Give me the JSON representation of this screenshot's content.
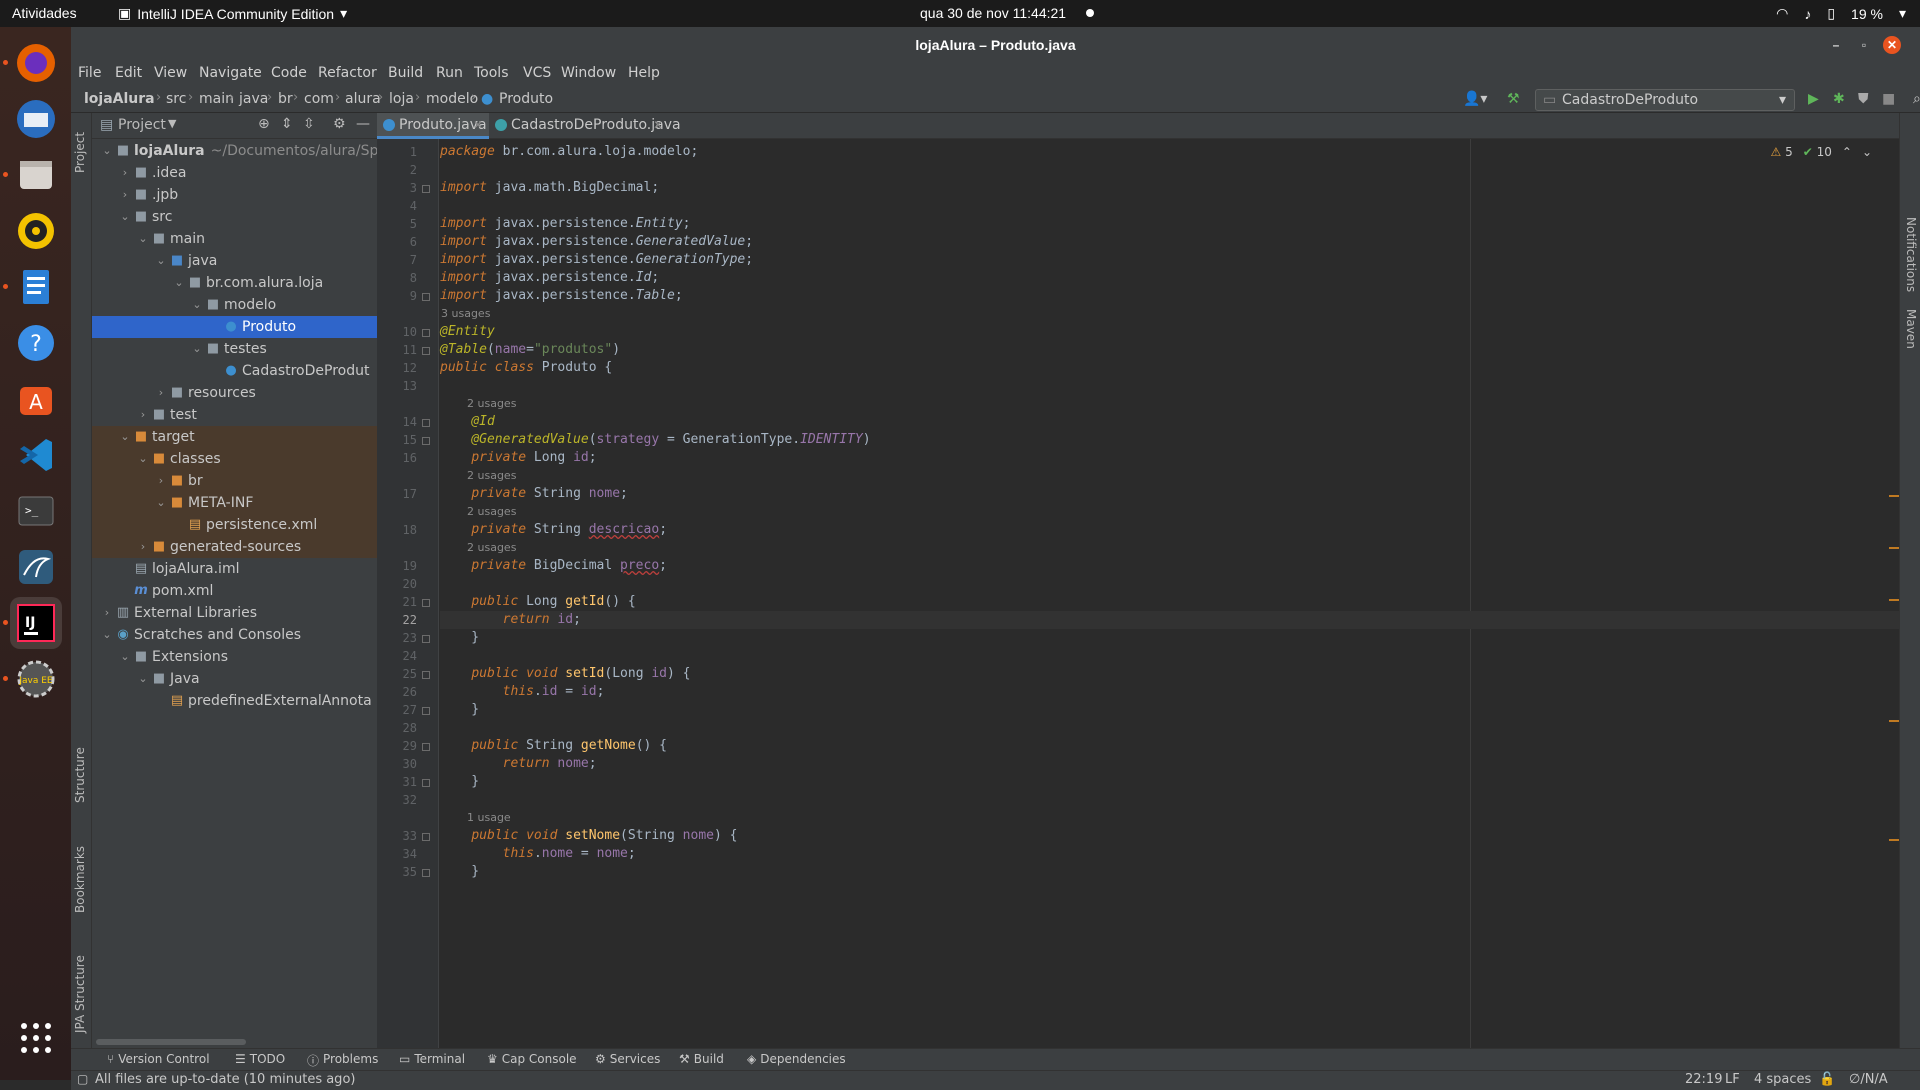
{
  "topbar": {
    "activities": "Atividades",
    "app_menu": "IntelliJ IDEA Community Edition",
    "clock": "qua 30 de nov  11:44:21",
    "battery": "19 %"
  },
  "window": {
    "title": "lojaAlura – Produto.java"
  },
  "menu": [
    "File",
    "Edit",
    "View",
    "Navigate",
    "Code",
    "Refactor",
    "Build",
    "Run",
    "Tools",
    "VCS",
    "Window",
    "Help"
  ],
  "breadcrumbs": [
    "lojaAlura",
    "src",
    "main",
    "java",
    "br",
    "com",
    "alura",
    "loja",
    "modelo",
    "Produto"
  ],
  "run_config": "CadastroDeProduto",
  "project_panel": {
    "title": "Project",
    "tree": [
      {
        "label": "lojaAlura",
        "suffix": "~/Documentos/alura/Sp",
        "depth": 0,
        "expanded": true,
        "icon": "module-folder-icon",
        "bold": true
      },
      {
        "label": ".idea",
        "depth": 1,
        "expanded": false,
        "icon": "folder-icon"
      },
      {
        "label": ".jpb",
        "depth": 1,
        "expanded": false,
        "icon": "folder-icon"
      },
      {
        "label": "src",
        "depth": 1,
        "expanded": true,
        "icon": "folder-icon"
      },
      {
        "label": "main",
        "depth": 2,
        "expanded": true,
        "icon": "folder-icon"
      },
      {
        "label": "java",
        "depth": 3,
        "expanded": true,
        "icon": "source-folder-icon"
      },
      {
        "label": "br.com.alura.loja",
        "depth": 4,
        "expanded": true,
        "icon": "package-icon"
      },
      {
        "label": "modelo",
        "depth": 5,
        "expanded": true,
        "icon": "package-icon"
      },
      {
        "label": "Produto",
        "depth": 6,
        "icon": "class-icon",
        "selected": true
      },
      {
        "label": "testes",
        "depth": 5,
        "expanded": true,
        "icon": "package-icon"
      },
      {
        "label": "CadastroDeProdut",
        "depth": 6,
        "icon": "class-icon"
      },
      {
        "label": "resources",
        "depth": 3,
        "expanded": false,
        "icon": "resources-folder-icon"
      },
      {
        "label": "test",
        "depth": 2,
        "expanded": false,
        "icon": "folder-icon"
      },
      {
        "label": "target",
        "depth": 1,
        "expanded": true,
        "icon": "excluded-folder-icon",
        "excluded": true
      },
      {
        "label": "classes",
        "depth": 2,
        "expanded": true,
        "icon": "excluded-folder-icon",
        "excluded": true
      },
      {
        "label": "br",
        "depth": 3,
        "expanded": false,
        "icon": "excluded-folder-icon",
        "excluded": true
      },
      {
        "label": "META-INF",
        "depth": 3,
        "expanded": true,
        "icon": "excluded-folder-icon",
        "excluded": true
      },
      {
        "label": "persistence.xml",
        "depth": 4,
        "icon": "xml-file-icon",
        "excluded": true
      },
      {
        "label": "generated-sources",
        "depth": 2,
        "expanded": false,
        "icon": "excluded-folder-icon",
        "excluded": true
      },
      {
        "label": "lojaAlura.iml",
        "depth": 1,
        "icon": "iml-file-icon"
      },
      {
        "label": "pom.xml",
        "depth": 1,
        "icon": "maven-file-icon"
      },
      {
        "label": "External Libraries",
        "depth": 0,
        "expanded": false,
        "icon": "libraries-icon"
      },
      {
        "label": "Scratches and Consoles",
        "depth": 0,
        "expanded": true,
        "icon": "scratches-icon"
      },
      {
        "label": "Extensions",
        "depth": 1,
        "expanded": true,
        "icon": "folder-icon"
      },
      {
        "label": "Java",
        "depth": 2,
        "expanded": true,
        "icon": "folder-icon"
      },
      {
        "label": "predefinedExternalAnnota",
        "depth": 3,
        "icon": "xml-file-icon"
      }
    ]
  },
  "left_stripe": [
    "Project",
    "Structure",
    "Bookmarks",
    "JPA Structure"
  ],
  "right_stripe": [
    "Notifications",
    "Maven"
  ],
  "tabs": [
    {
      "label": "Produto.java",
      "active": true
    },
    {
      "label": "CadastroDeProduto.java",
      "active": false
    }
  ],
  "inspections": {
    "warnings": "5",
    "ok": "10"
  },
  "editor": {
    "current_line": "22",
    "lines": [
      {
        "n": "1",
        "code": "package br.com.alura.loja.modelo;"
      },
      {
        "n": "2",
        "code": ""
      },
      {
        "n": "3",
        "code": "import java.math.BigDecimal;"
      },
      {
        "n": "4",
        "code": ""
      },
      {
        "n": "5",
        "code": "import javax.persistence.Entity;"
      },
      {
        "n": "6",
        "code": "import javax.persistence.GeneratedValue;"
      },
      {
        "n": "7",
        "code": "import javax.persistence.GenerationType;"
      },
      {
        "n": "8",
        "code": "import javax.persistence.Id;"
      },
      {
        "n": "9",
        "code": "import javax.persistence.Table;"
      },
      {
        "hint": "3 usages"
      },
      {
        "n": "10",
        "code": "@Entity"
      },
      {
        "n": "11",
        "code": "@Table(name=\"produtos\")"
      },
      {
        "n": "12",
        "code": "public class Produto {"
      },
      {
        "n": "13",
        "code": ""
      },
      {
        "hint": "2 usages",
        "indent": 1
      },
      {
        "n": "14",
        "code": "    @Id"
      },
      {
        "n": "15",
        "code": "    @GeneratedValue(strategy = GenerationType.IDENTITY)"
      },
      {
        "n": "16",
        "code": "    private Long id;"
      },
      {
        "hint": "2 usages",
        "indent": 1
      },
      {
        "n": "17",
        "code": "    private String nome;"
      },
      {
        "hint": "2 usages",
        "indent": 1
      },
      {
        "n": "18",
        "code": "    private String descricao;"
      },
      {
        "hint": "2 usages",
        "indent": 1
      },
      {
        "n": "19",
        "code": "    private BigDecimal preco;"
      },
      {
        "n": "20",
        "code": ""
      },
      {
        "n": "21",
        "code": "    public Long getId() {"
      },
      {
        "n": "22",
        "code": "        return id;"
      },
      {
        "n": "23",
        "code": "    }"
      },
      {
        "n": "24",
        "code": ""
      },
      {
        "n": "25",
        "code": "    public void setId(Long id) {"
      },
      {
        "n": "26",
        "code": "        this.id = id;"
      },
      {
        "n": "27",
        "code": "    }"
      },
      {
        "n": "28",
        "code": ""
      },
      {
        "n": "29",
        "code": "    public String getNome() {"
      },
      {
        "n": "30",
        "code": "        return nome;"
      },
      {
        "n": "31",
        "code": "    }"
      },
      {
        "n": "32",
        "code": ""
      },
      {
        "hint": "1 usage",
        "indent": 1
      },
      {
        "n": "33",
        "code": "    public void setNome(String nome) {"
      },
      {
        "n": "34",
        "code": "        this.nome = nome;"
      },
      {
        "n": "35",
        "code": "    }"
      }
    ]
  },
  "bottom_tools": [
    "Version Control",
    "TODO",
    "Problems",
    "Terminal",
    "Cap Console",
    "Services",
    "Build",
    "Dependencies"
  ],
  "status": {
    "message": "All files are up-to-date (10 minutes ago)",
    "position": "22:19",
    "line_sep": "LF",
    "indent": "4 spaces",
    "vcs": "∅/N/A"
  },
  "colors": {
    "keyword": "#cc7832",
    "string": "#6a8759",
    "annotation": "#bbb529",
    "field": "#9876aa",
    "method": "#ffc66d",
    "selection": "#2f65ca",
    "excluded_bg": "#4a3a2c"
  }
}
